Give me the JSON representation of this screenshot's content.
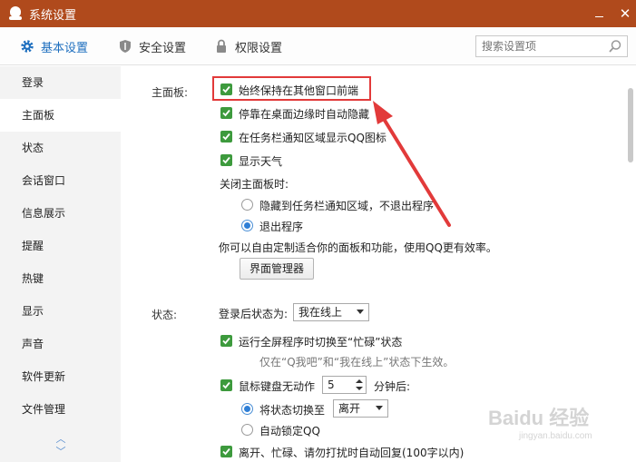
{
  "window": {
    "title": "系统设置",
    "minimize": "—",
    "close": "✕"
  },
  "tabs": [
    {
      "label": "基本设置",
      "icon": "gear-icon",
      "active": true
    },
    {
      "label": "安全设置",
      "icon": "shield-icon",
      "active": false
    },
    {
      "label": "权限设置",
      "icon": "lock-icon",
      "active": false
    }
  ],
  "search": {
    "placeholder": "搜索设置项"
  },
  "sidebar": {
    "items": [
      {
        "label": "登录"
      },
      {
        "label": "主面板",
        "active": true
      },
      {
        "label": "状态"
      },
      {
        "label": "会话窗口"
      },
      {
        "label": "信息展示"
      },
      {
        "label": "提醒"
      },
      {
        "label": "热键"
      },
      {
        "label": "显示"
      },
      {
        "label": "声音"
      },
      {
        "label": "软件更新"
      },
      {
        "label": "文件管理"
      }
    ],
    "scroll_up": "︿",
    "scroll_down": "﹀"
  },
  "main_panel": {
    "section_label": "主面板:",
    "always_on_top": "始终保持在其他窗口前端",
    "auto_hide": "停靠在桌面边缘时自动隐藏",
    "tray_icon": "在任务栏通知区域显示QQ图标",
    "show_weather": "显示天气",
    "close_label": "关闭主面板时:",
    "close_option_hide": "隐藏到任务栏通知区域，不退出程序",
    "close_option_exit": "退出程序",
    "customize_text": "你可以自由定制适合你的面板和功能，使用QQ更有效率。",
    "manager_button": "界面管理器"
  },
  "status_section": {
    "section_label": "状态:",
    "login_status_label": "登录后状态为:",
    "login_status_value": "我在线上",
    "fullscreen_busy": "运行全屏程序时切换至“忙碌”状态",
    "fullscreen_hint": "仅在“Q我吧”和“我在线上”状态下生效。",
    "idle_label": "鼠标键盘无动作",
    "idle_minutes": "5",
    "idle_suffix": "分钟后:",
    "switch_status_label": "将状态切换至",
    "switch_status_value": "离开",
    "auto_lock": "自动锁定QQ",
    "auto_reply": "离开、忙碌、请勿打扰时自动回复(100字以内)"
  },
  "watermark": {
    "main": "Baidu 经验",
    "sub": "jingyan.baidu.com"
  },
  "colors": {
    "titlebar": "#b04a1c",
    "accent": "#1e6fbf",
    "checkbox": "#3d9a3d",
    "highlight": "#e23a3a"
  }
}
